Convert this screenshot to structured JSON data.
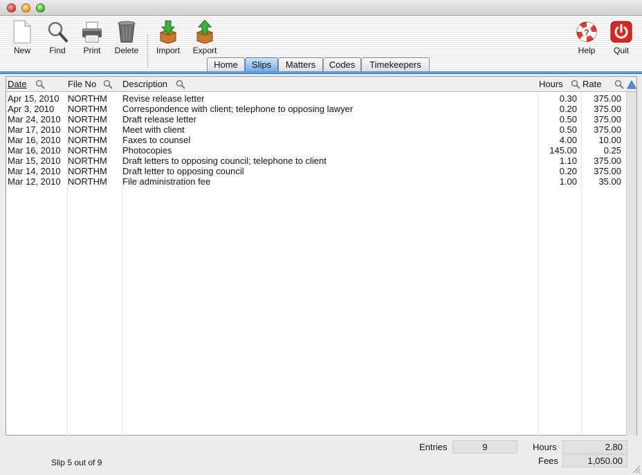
{
  "toolbar": {
    "buttons": [
      {
        "id": "new",
        "label": "New",
        "icon": "document-icon"
      },
      {
        "id": "find",
        "label": "Find",
        "icon": "magnifier-icon"
      },
      {
        "id": "print",
        "label": "Print",
        "icon": "printer-icon"
      },
      {
        "id": "delete",
        "label": "Delete",
        "icon": "trash-icon"
      },
      {
        "id": "import",
        "label": "Import",
        "icon": "import-box-icon"
      },
      {
        "id": "export",
        "label": "Export",
        "icon": "export-box-icon"
      },
      {
        "id": "help",
        "label": "Help",
        "icon": "lifebuoy-icon"
      },
      {
        "id": "quit",
        "label": "Quit",
        "icon": "power-icon"
      }
    ]
  },
  "tabs": [
    "Home",
    "Slips",
    "Matters",
    "Codes",
    "Timekeepers"
  ],
  "active_tab": "Slips",
  "table": {
    "columns": {
      "date": "Date",
      "file_no": "File No",
      "description": "Description",
      "hours": "Hours",
      "rate": "Rate"
    },
    "rows": [
      {
        "date": "Apr 15, 2010",
        "file_no": "NORTHM",
        "description": "Revise release letter",
        "hours": "0.30",
        "rate": "375.00"
      },
      {
        "date": "Apr 3, 2010",
        "file_no": "NORTHM",
        "description": "Correspondence with client; telephone to opposing lawyer",
        "hours": "0.20",
        "rate": "375.00"
      },
      {
        "date": "Mar 24, 2010",
        "file_no": "NORTHM",
        "description": "Draft release letter",
        "hours": "0.50",
        "rate": "375.00"
      },
      {
        "date": "Mar 17, 2010",
        "file_no": "NORTHM",
        "description": "Meet with client",
        "hours": "0.50",
        "rate": "375.00"
      },
      {
        "date": "Mar 16, 2010",
        "file_no": "NORTHM",
        "description": "Faxes to counsel",
        "hours": "4.00",
        "rate": "10.00"
      },
      {
        "date": "Mar 16, 2010",
        "file_no": "NORTHM",
        "description": "Photocopies",
        "hours": "145.00",
        "rate": "0.25"
      },
      {
        "date": "Mar 15, 2010",
        "file_no": "NORTHM",
        "description": "Draft letters to opposing council; telephone to client",
        "hours": "1.10",
        "rate": "375.00"
      },
      {
        "date": "Mar 14, 2010",
        "file_no": "NORTHM",
        "description": "Draft letter to opposing council",
        "hours": "0.20",
        "rate": "375.00"
      },
      {
        "date": "Mar 12, 2010",
        "file_no": "NORTHM",
        "description": "File administration fee",
        "hours": "1.00",
        "rate": "35.00"
      }
    ]
  },
  "footer": {
    "slip_status": "Slip 5 out of 9",
    "entries_label": "Entries",
    "entries_value": "9",
    "hours_label": "Hours",
    "hours_value": "2.80",
    "fees_label": "Fees",
    "fees_value": "1,050.00"
  },
  "colors": {
    "tab_active": "#6fa9e8",
    "accent_line": "#5d9be0",
    "close": "#ee4e46",
    "minimize": "#f4b636",
    "zoom": "#5bc43e"
  }
}
